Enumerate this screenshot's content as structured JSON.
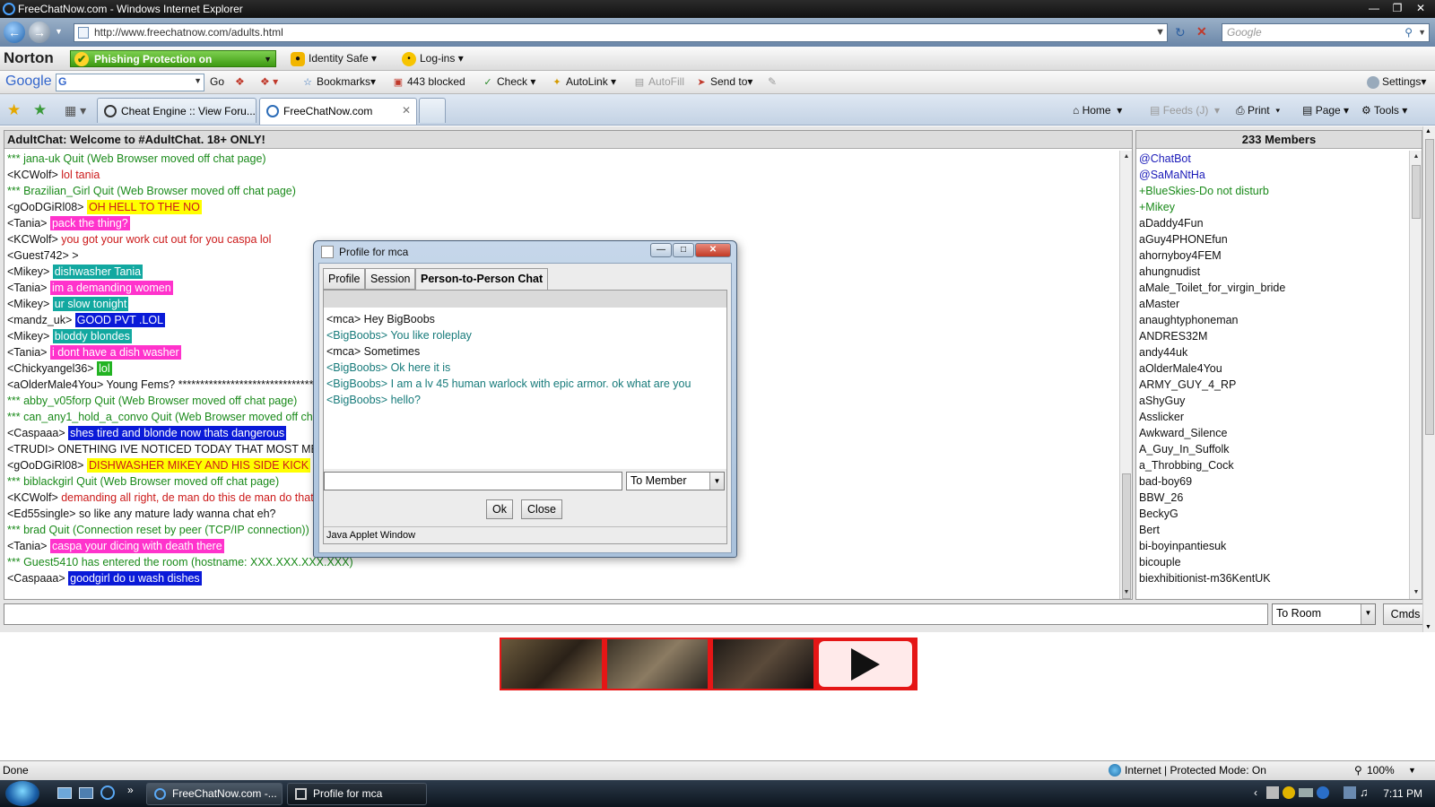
{
  "window": {
    "title": "FreeChatNow.com - Windows Internet Explorer"
  },
  "address": {
    "url": "http://www.freechatnow.com/adults.html",
    "search_placeholder": "Google"
  },
  "norton": {
    "logo": "Norton",
    "phishing": "Phishing Protection on",
    "identity": "Identity Safe",
    "logins": "Log-ins"
  },
  "google_bar": {
    "logo": "Google",
    "go": "Go",
    "bookmarks": "Bookmarks",
    "blocked": "443 blocked",
    "check": "Check",
    "autolink": "AutoLink",
    "autofill": "AutoFill",
    "sendto": "Send to",
    "settings": "Settings"
  },
  "tabs": [
    {
      "label": "Cheat Engine :: View Foru..."
    },
    {
      "label": "FreeChatNow.com"
    }
  ],
  "commands": {
    "home": "Home",
    "feeds": "Feeds (J)",
    "print": "Print",
    "page": "Page",
    "tools": "Tools"
  },
  "chat": {
    "header": "AdultChat: Welcome to #AdultChat. 18+ ONLY!",
    "lines": [
      {
        "nick": "",
        "sys": "*** jana-uk Quit (Web Browser moved off chat page)",
        "msg": "",
        "color": "",
        "bg": ""
      },
      {
        "nick": "<KCWolf>",
        "sys": "",
        "msg": "lol tania",
        "color": "#cc1a1a",
        "bg": ""
      },
      {
        "nick": "",
        "sys": "*** Brazilian_Girl Quit (Web Browser moved off chat page)",
        "msg": "",
        "color": "",
        "bg": ""
      },
      {
        "nick": "<gOoDGiRl08>",
        "sys": "",
        "msg": "OH HELL TO THE NO",
        "color": "#cc1a1a",
        "bg": "#ffff00"
      },
      {
        "nick": "<Tania>",
        "sys": "",
        "msg": "pack the thing?",
        "color": "#ffffff",
        "bg": "#ff33cc"
      },
      {
        "nick": "<KCWolf>",
        "sys": "",
        "msg": "you got your work cut out for you caspa lol",
        "color": "#cc1a1a",
        "bg": ""
      },
      {
        "nick": "<Guest742>",
        "sys": "",
        "msg": ">",
        "color": "#111111",
        "bg": ""
      },
      {
        "nick": "<Mikey>",
        "sys": "",
        "msg": "dishwasher Tania",
        "color": "#ffffff",
        "bg": "#12a8a0"
      },
      {
        "nick": "<Tania>",
        "sys": "",
        "msg": "im a demanding women",
        "color": "#ffffff",
        "bg": "#ff33cc"
      },
      {
        "nick": "<Mikey>",
        "sys": "",
        "msg": "ur slow tonight",
        "color": "#ffffff",
        "bg": "#12a8a0"
      },
      {
        "nick": "<mandz_uk>",
        "sys": "",
        "msg": "GOOD PVT .LOL",
        "color": "#ffffff",
        "bg": "#0a1ad8"
      },
      {
        "nick": "<Mikey>",
        "sys": "",
        "msg": "bloddy blondes",
        "color": "#ffffff",
        "bg": "#12a8a0"
      },
      {
        "nick": "<Tania>",
        "sys": "",
        "msg": "i dont have a dish washer",
        "color": "#ffffff",
        "bg": "#ff33cc"
      },
      {
        "nick": "<Chickyangel36>",
        "sys": "",
        "msg": "lol",
        "color": "#ffffff",
        "bg": "#22b322"
      },
      {
        "nick": "<aOlderMale4You>",
        "sys": "",
        "msg": "Young Fems? ***********************************",
        "color": "#111111",
        "bg": ""
      },
      {
        "nick": "",
        "sys": "*** abby_v05forp Quit (Web Browser moved off chat page)",
        "msg": "",
        "color": "",
        "bg": ""
      },
      {
        "nick": "",
        "sys": "*** can_any1_hold_a_convo Quit (Web Browser moved off chat page)",
        "msg": "",
        "color": "",
        "bg": ""
      },
      {
        "nick": "<Caspaaa>",
        "sys": "",
        "msg": "shes tired and blonde now thats dangerous",
        "color": "#ffffff",
        "bg": "#0a1ad8"
      },
      {
        "nick": "<TRUDI>",
        "sys": "",
        "msg": "ONETHING IVE NOTICED TODAY THAT MOST MEN ARE MARRIED",
        "color": "#111111",
        "bg": ""
      },
      {
        "nick": "<gOoDGiRl08>",
        "sys": "",
        "msg": "DISHWASHER MIKEY AND HIS SIDE KICK",
        "color": "#cc1a1a",
        "bg": "#ffff00"
      },
      {
        "nick": "",
        "sys": "*** biblackgirl Quit (Web Browser moved off chat page)",
        "msg": "",
        "color": "",
        "bg": ""
      },
      {
        "nick": "<KCWolf>",
        "sys": "",
        "msg": "demanding all right, de man do this de man do that",
        "color": "#cc1a1a",
        "bg": ""
      },
      {
        "nick": "<Ed55single>",
        "sys": "",
        "msg": "so like any mature lady wanna chat eh?",
        "color": "#111111",
        "bg": ""
      },
      {
        "nick": "",
        "sys": "*** brad Quit (Connection reset by peer (TCP/IP connection))",
        "msg": "",
        "color": "",
        "bg": ""
      },
      {
        "nick": "<Tania>",
        "sys": "",
        "msg": "caspa your dicing with death there",
        "color": "#ffffff",
        "bg": "#ff33cc"
      },
      {
        "nick": "",
        "sys": "*** Guest5410 has entered the room (hostname: XXX.XXX.XXX.XXX)",
        "msg": "",
        "color": "",
        "bg": ""
      },
      {
        "nick": "<Caspaaa>",
        "sys": "",
        "msg": "goodgirl do u wash dishes",
        "color": "#ffffff",
        "bg": "#0a1ad8"
      }
    ],
    "to_room": "To Room",
    "cmds": "Cmds"
  },
  "members": {
    "header": "233 Members",
    "list": [
      {
        "name": "@ChatBot",
        "kind": "op"
      },
      {
        "name": "@SaMaNtHa",
        "kind": "op"
      },
      {
        "name": "+BlueSkies-Do not disturb",
        "kind": "voice"
      },
      {
        "name": "+Mikey",
        "kind": "voice"
      },
      {
        "name": "aDaddy4Fun",
        "kind": ""
      },
      {
        "name": "aGuy4PHONEfun",
        "kind": ""
      },
      {
        "name": "ahornyboy4FEM",
        "kind": ""
      },
      {
        "name": "ahungnudist",
        "kind": ""
      },
      {
        "name": "aMale_Toilet_for_virgin_bride",
        "kind": ""
      },
      {
        "name": "aMaster",
        "kind": ""
      },
      {
        "name": "anaughtyphoneman",
        "kind": ""
      },
      {
        "name": "ANDRES32M",
        "kind": ""
      },
      {
        "name": "andy44uk",
        "kind": ""
      },
      {
        "name": "aOlderMale4You",
        "kind": ""
      },
      {
        "name": "ARMY_GUY_4_RP",
        "kind": ""
      },
      {
        "name": "aShyGuy",
        "kind": ""
      },
      {
        "name": "Asslicker",
        "kind": ""
      },
      {
        "name": "Awkward_Silence",
        "kind": ""
      },
      {
        "name": "A_Guy_In_Suffolk",
        "kind": ""
      },
      {
        "name": "a_Throbbing_Cock",
        "kind": ""
      },
      {
        "name": "bad-boy69",
        "kind": ""
      },
      {
        "name": "BBW_26",
        "kind": ""
      },
      {
        "name": "BeckyG",
        "kind": ""
      },
      {
        "name": "Bert",
        "kind": ""
      },
      {
        "name": "bi-boyinpantiesuk",
        "kind": ""
      },
      {
        "name": "bicouple",
        "kind": ""
      },
      {
        "name": "biexhibitionist-m36KentUK",
        "kind": ""
      }
    ]
  },
  "dialog": {
    "title": "Profile for mca",
    "tabs": [
      {
        "label": "Profile"
      },
      {
        "label": "Session"
      },
      {
        "label": "Person-to-Person Chat"
      }
    ],
    "messages": [
      {
        "text": "<mca>  Hey BigBoobs",
        "kind": "me"
      },
      {
        "text": "<BigBoobs> You like roleplay",
        "kind": "them"
      },
      {
        "text": "<mca>  Sometimes",
        "kind": "me"
      },
      {
        "text": "<BigBoobs> Ok here it is",
        "kind": "them"
      },
      {
        "text": "<BigBoobs> I am a lv 45 human warlock with epic armor. ok what are you",
        "kind": "them"
      },
      {
        "text": "<BigBoobs> hello?",
        "kind": "them"
      }
    ],
    "to_member": "To Member",
    "ok": "Ok",
    "close": "Close",
    "footer": "Java Applet Window"
  },
  "status": {
    "left": "Done",
    "zone": "Internet | Protected Mode: On",
    "zoom": "100%"
  },
  "taskbar": {
    "items": [
      {
        "label": "FreeChatNow.com -..."
      },
      {
        "label": "Profile for mca"
      }
    ],
    "clock": "7:11 PM"
  }
}
